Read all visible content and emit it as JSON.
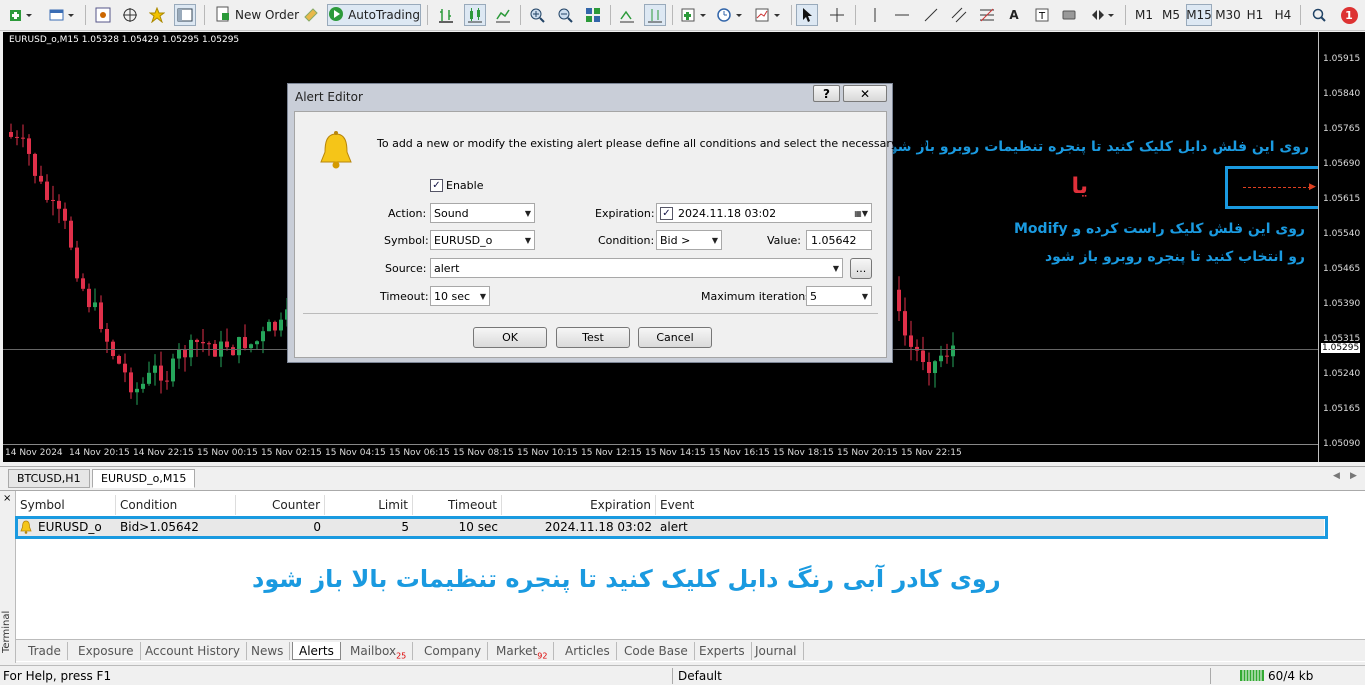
{
  "toolbar": {
    "new_order_label": "New Order",
    "autotrading_label": "AutoTrading",
    "timeframes": [
      "M1",
      "M5",
      "M15",
      "M30",
      "H1",
      "H4"
    ],
    "active_timeframe": "M15",
    "notification_count": "1",
    "text_tool_label": "A"
  },
  "chart": {
    "info": "EURUSD_o,M15  1.05328 1.05429 1.05295 1.05295",
    "price_ticks": [
      "1.05915",
      "1.05840",
      "1.05765",
      "1.05690",
      "1.05615",
      "1.05540",
      "1.05465",
      "1.05390",
      "1.05315",
      "1.05295",
      "1.05240",
      "1.05165",
      "1.05090"
    ],
    "current_price": "1.05295",
    "time_ticks": [
      "14 Nov 2024",
      "14 Nov 20:15",
      "14 Nov 22:15",
      "15 Nov 00:15",
      "15 Nov 02:15",
      "15 Nov 04:15",
      "15 Nov 06:15",
      "15 Nov 08:15",
      "15 Nov 10:15",
      "15 Nov 12:15",
      "15 Nov 14:15",
      "15 Nov 16:15",
      "15 Nov 18:15",
      "15 Nov 20:15",
      "15 Nov 22:15"
    ],
    "colors": {
      "up": "#26a65b",
      "down": "#e0304a",
      "background": "#000000"
    }
  },
  "annotations": {
    "line1": "روی این فلش دابل کلیک کنید تا پنجره تنظیمات روبرو باز شود",
    "or": "یا",
    "line2": "روی این فلش کلیک راست کرده و  Modify",
    "line3": "رو انتخاب کنید تا پنجره روبرو باز شود",
    "bottom": "روی کادر آبی رنگ دابل کلیک کنید تا پنجره تنظیمات بالا باز شود",
    "accent_color": "#1a9ae0"
  },
  "dialog": {
    "title": "Alert Editor",
    "help_label": "?",
    "close_label": "✕",
    "intro": "To add a new or modify the existing alert please define all conditions and select the necessary action.",
    "enable_label": "Enable",
    "action_label": "Action:",
    "action_value": "Sound",
    "expiration_label": "Expiration:",
    "expiration_value": "2024.11.18 03:02",
    "symbol_label": "Symbol:",
    "symbol_value": "EURUSD_o",
    "condition_label": "Condition:",
    "condition_value": "Bid >",
    "value_label": "Value:",
    "value_value": "1.05642",
    "source_label": "Source:",
    "source_value": "alert",
    "browse_label": "...",
    "timeout_label": "Timeout:",
    "timeout_value": "10 sec",
    "max_iter_label": "Maximum iterations:",
    "max_iter_value": "5",
    "ok_label": "OK",
    "test_label": "Test",
    "cancel_label": "Cancel"
  },
  "chart_tabs": [
    "BTCUSD,H1",
    "EURUSD_o,M15"
  ],
  "terminal": {
    "side_label": "Terminal",
    "close_label": "×",
    "headers": [
      "Symbol",
      "Condition",
      "Counter",
      "Limit",
      "Timeout",
      "Expiration",
      "Event"
    ],
    "row": {
      "symbol": "EURUSD_o",
      "condition": "Bid>1.05642",
      "counter": "0",
      "limit": "5",
      "timeout": "10 sec",
      "expiration": "2024.11.18 03:02",
      "event": "alert"
    },
    "tabs": [
      "Trade",
      "Exposure",
      "Account History",
      "News",
      "Alerts",
      "Mailbox",
      "Company",
      "Market",
      "Articles",
      "Code Base",
      "Experts",
      "Journal"
    ],
    "mailbox_count": "25",
    "market_count": "92",
    "active_tab": "Alerts"
  },
  "status": {
    "help": "For Help, press F1",
    "profile": "Default",
    "traffic": "60/4 kb"
  }
}
